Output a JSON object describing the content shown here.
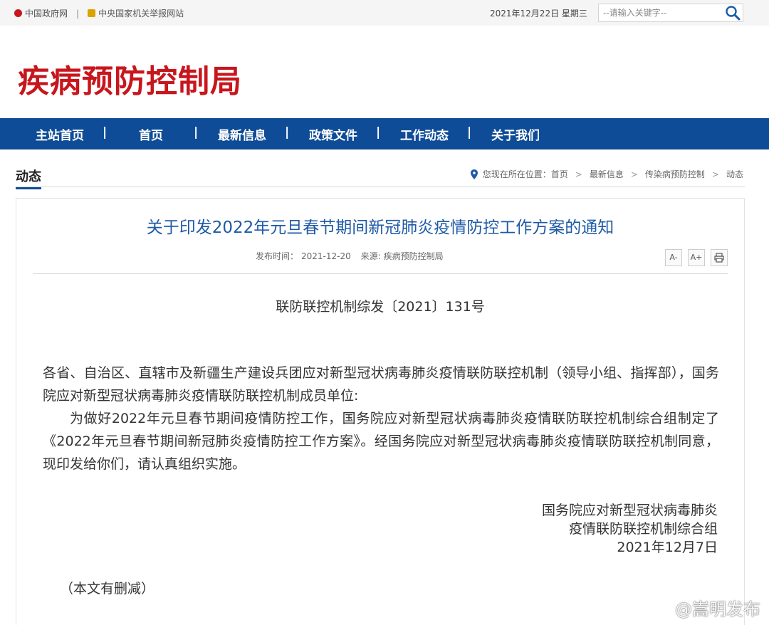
{
  "topbar": {
    "link1": "中国政府网",
    "separator": "|",
    "link2": "中央国家机关举报网站",
    "date": "2021年12月22日 星期三",
    "search_placeholder": "--请输入关键字--"
  },
  "header": {
    "logo_text": "疾病预防控制局"
  },
  "nav": {
    "items": [
      "主站首页",
      "首页",
      "最新信息",
      "政策文件",
      "工作动态",
      "关于我们"
    ]
  },
  "section": {
    "title": "动态"
  },
  "breadcrumb": {
    "prefix": "您现在所在位置：",
    "items": [
      "首页",
      "最新信息",
      "传染病预防控制",
      "动态"
    ],
    "separator": ">"
  },
  "article": {
    "title": "关于印发2022年元旦春节期间新冠肺炎疫情防控工作方案的通知",
    "publish_label": "发布时间：",
    "publish_date": "2021-12-20",
    "source_label": "来源:",
    "source": "疾病预防控制局",
    "tools": {
      "decrease": "A-",
      "increase": "A+"
    },
    "doc_number": "联防联控机制综发〔2021〕131号",
    "para1": "各省、自治区、直辖市及新疆生产建设兵团应对新型冠状病毒肺炎疫情联防联控机制（领导小组、指挥部），国务院应对新型冠状病毒肺炎疫情联防联控机制成员单位:",
    "para2": "为做好2022年元旦春节期间疫情防控工作，国务院应对新型冠状病毒肺炎疫情联防联控机制综合组制定了《2022年元旦春节期间新冠肺炎疫情防控工作方案》。经国务院应对新型冠状病毒肺炎疫情联防联控机制同意，现印发给你们，请认真组织实施。",
    "sign_line1": "国务院应对新型冠状病毒肺炎",
    "sign_line2": "疫情联防联控机制综合组",
    "sign_date": "2021年12月7日",
    "note": "（本文有删减）"
  },
  "watermark": {
    "text": "@嵩明发布"
  },
  "colors": {
    "brand_red": "#c8161d",
    "nav_blue": "#0f4c97",
    "title_blue": "#1f5aa6"
  }
}
